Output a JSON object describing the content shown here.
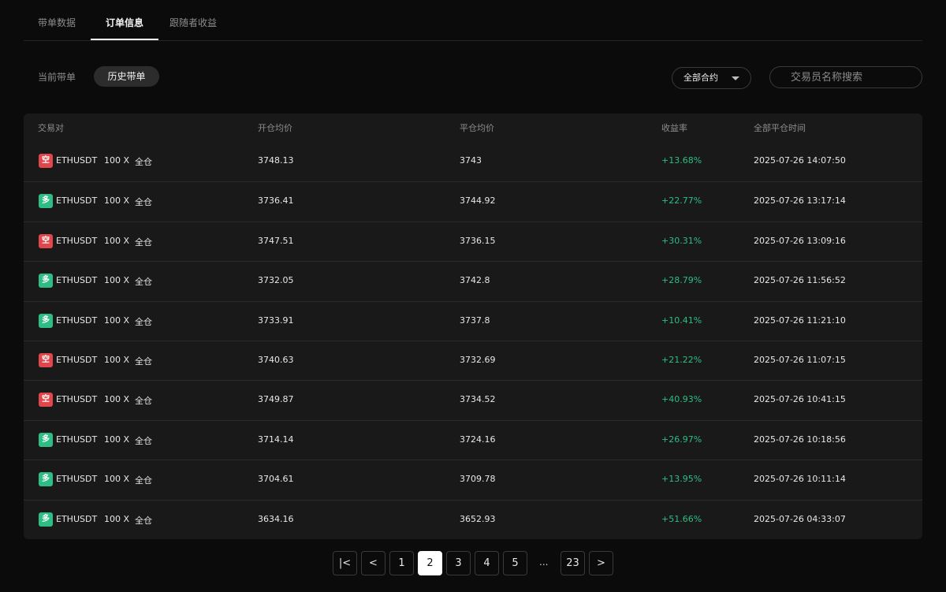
{
  "tabs": [
    {
      "label": "带单数据",
      "active": false
    },
    {
      "label": "订单信息",
      "active": true
    },
    {
      "label": "跟随者收益",
      "active": false
    }
  ],
  "subtabs": {
    "current": "当前带单",
    "history": "历史带单"
  },
  "filter": {
    "selected": "全部合约",
    "search_placeholder": "交易员名称搜索"
  },
  "table": {
    "columns": [
      "交易对",
      "开仓均价",
      "平仓均价",
      "收益率",
      "全部平仓时间"
    ],
    "rows": [
      {
        "side": "空",
        "side_type": "short",
        "pair": "ETHUSDT",
        "leverage": "100 X",
        "mode": "全仓",
        "open": "3748.13",
        "close": "3743",
        "pnl": "+13.68%",
        "time": "2025-07-26 14:07:50"
      },
      {
        "side": "多",
        "side_type": "long",
        "pair": "ETHUSDT",
        "leverage": "100 X",
        "mode": "全仓",
        "open": "3736.41",
        "close": "3744.92",
        "pnl": "+22.77%",
        "time": "2025-07-26 13:17:14"
      },
      {
        "side": "空",
        "side_type": "short",
        "pair": "ETHUSDT",
        "leverage": "100 X",
        "mode": "全仓",
        "open": "3747.51",
        "close": "3736.15",
        "pnl": "+30.31%",
        "time": "2025-07-26 13:09:16"
      },
      {
        "side": "多",
        "side_type": "long",
        "pair": "ETHUSDT",
        "leverage": "100 X",
        "mode": "全仓",
        "open": "3732.05",
        "close": "3742.8",
        "pnl": "+28.79%",
        "time": "2025-07-26 11:56:52"
      },
      {
        "side": "多",
        "side_type": "long",
        "pair": "ETHUSDT",
        "leverage": "100 X",
        "mode": "全仓",
        "open": "3733.91",
        "close": "3737.8",
        "pnl": "+10.41%",
        "time": "2025-07-26 11:21:10"
      },
      {
        "side": "空",
        "side_type": "short",
        "pair": "ETHUSDT",
        "leverage": "100 X",
        "mode": "全仓",
        "open": "3740.63",
        "close": "3732.69",
        "pnl": "+21.22%",
        "time": "2025-07-26 11:07:15"
      },
      {
        "side": "空",
        "side_type": "short",
        "pair": "ETHUSDT",
        "leverage": "100 X",
        "mode": "全仓",
        "open": "3749.87",
        "close": "3734.52",
        "pnl": "+40.93%",
        "time": "2025-07-26 10:41:15"
      },
      {
        "side": "多",
        "side_type": "long",
        "pair": "ETHUSDT",
        "leverage": "100 X",
        "mode": "全仓",
        "open": "3714.14",
        "close": "3724.16",
        "pnl": "+26.97%",
        "time": "2025-07-26 10:18:56"
      },
      {
        "side": "多",
        "side_type": "long",
        "pair": "ETHUSDT",
        "leverage": "100 X",
        "mode": "全仓",
        "open": "3704.61",
        "close": "3709.78",
        "pnl": "+13.95%",
        "time": "2025-07-26 10:11:14"
      },
      {
        "side": "多",
        "side_type": "long",
        "pair": "ETHUSDT",
        "leverage": "100 X",
        "mode": "全仓",
        "open": "3634.16",
        "close": "3652.93",
        "pnl": "+51.66%",
        "time": "2025-07-26 04:33:07"
      }
    ]
  },
  "pagination": {
    "first": "|<",
    "prev": "<",
    "next": ">",
    "pages": [
      "1",
      "2",
      "3",
      "4",
      "5"
    ],
    "current": "2",
    "ellipsis": "...",
    "last": "23"
  },
  "colors": {
    "short": "#e0474c",
    "long": "#2ebd85",
    "profit": "#2ebd85"
  }
}
